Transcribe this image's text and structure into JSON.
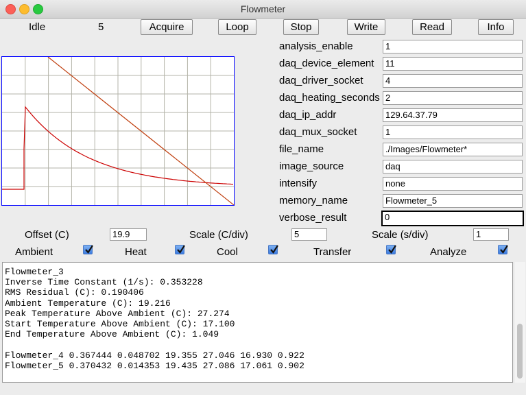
{
  "window": {
    "title": "Flowmeter"
  },
  "status": {
    "state": "Idle",
    "count": "5"
  },
  "toolbar": {
    "acquire": "Acquire",
    "loop": "Loop",
    "stop": "Stop",
    "write": "Write",
    "read": "Read",
    "info": "Info"
  },
  "params": [
    {
      "label": "analysis_enable",
      "value": "1"
    },
    {
      "label": "daq_device_element",
      "value": "11"
    },
    {
      "label": "daq_driver_socket",
      "value": "4"
    },
    {
      "label": "daq_heating_seconds",
      "value": "2"
    },
    {
      "label": "daq_ip_addr",
      "value": "129.64.37.79"
    },
    {
      "label": "daq_mux_socket",
      "value": "1"
    },
    {
      "label": "file_name",
      "value": "./Images/Flowmeter*"
    },
    {
      "label": "image_source",
      "value": "daq"
    },
    {
      "label": "intensify",
      "value": "none"
    },
    {
      "label": "memory_name",
      "value": "Flowmeter_5"
    },
    {
      "label": "verbose_result",
      "value": "0"
    }
  ],
  "controls": {
    "offset_label": "Offset (C)",
    "offset_value": "19.9",
    "scale_c_label": "Scale (C/div)",
    "scale_c_value": "5",
    "scale_s_label": "Scale (s/div)",
    "scale_s_value": "1"
  },
  "checkboxes": [
    {
      "label": "Ambient",
      "checked": true
    },
    {
      "label": "Heat",
      "checked": true
    },
    {
      "label": "Cool",
      "checked": true
    },
    {
      "label": "Transfer",
      "checked": true
    },
    {
      "label": "Analyze",
      "checked": true
    }
  ],
  "output_text": "Flowmeter_3\nInverse Time Constant (1/s): 0.353228\nRMS Residual (C): 0.190406\nAmbient Temperature (C): 19.216\nPeak Temperature Above Ambient (C): 27.274\nStart Temperature Above Ambient (C): 17.100\nEnd Temperature Above Ambient (C): 1.049\n\nFlowmeter_4 0.367444 0.048702 19.355 27.046 16.930 0.922\nFlowmeter_5 0.370432 0.014353 19.435 27.086 17.061 0.902",
  "colors": {
    "plot_border": "#0000ff",
    "grid": "#b3b3a8",
    "trace": "#cc0000",
    "fit_line": "#c04010"
  }
}
